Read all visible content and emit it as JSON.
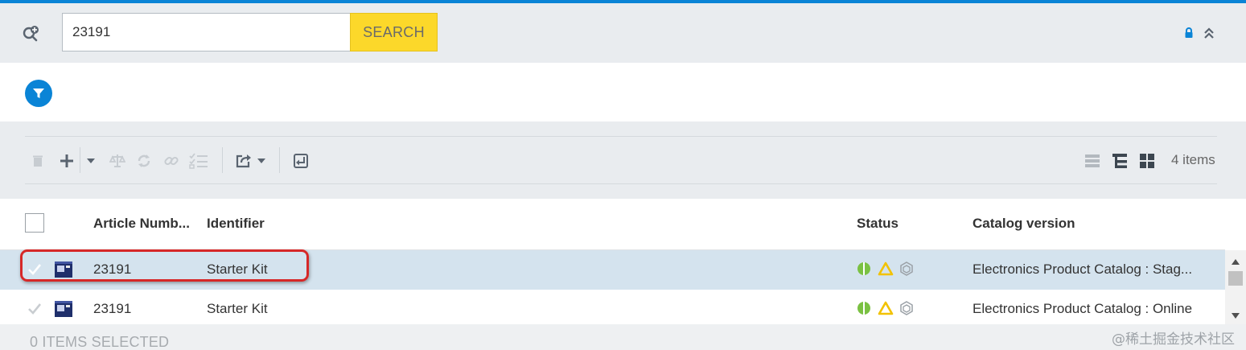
{
  "search": {
    "value": "23191",
    "button_label": "SEARCH"
  },
  "toolbar": {
    "item_count": "4 items"
  },
  "table": {
    "columns": [
      "Article Numb...",
      "Identifier",
      "Status",
      "Catalog version"
    ],
    "rows": [
      {
        "article_number": "23191",
        "identifier": "Starter Kit",
        "catalog_version": "Electronics Product Catalog : Stag...",
        "selected": true
      },
      {
        "article_number": "23191",
        "identifier": "Starter Kit",
        "catalog_version": "Electronics Product Catalog : Online",
        "selected": false
      }
    ]
  },
  "footer": {
    "selection_text": "0 ITEMS SELECTED"
  },
  "watermark": "@稀土掘金技术社区",
  "colors": {
    "accent_blue": "#0a84d6",
    "search_button": "#fcd82a",
    "selected_row": "#d4e3ee",
    "highlight_red": "#d62828",
    "status_green": "#7ac142",
    "status_yellow": "#f2c200"
  },
  "icons": [
    "advanced-search-icon",
    "lock-icon",
    "collapse-icon",
    "filter-icon",
    "delete-icon",
    "add-icon",
    "dropdown-icon",
    "compare-icon",
    "sync-icon",
    "link-icon",
    "checklist-icon",
    "export-icon",
    "import-icon",
    "list-view-icon",
    "tree-view-icon",
    "grid-view-icon",
    "check-icon",
    "product-thumbnail-icon",
    "approval-status-icon",
    "warning-icon",
    "sync-status-icon",
    "scroll-up-icon",
    "scroll-down-icon"
  ]
}
